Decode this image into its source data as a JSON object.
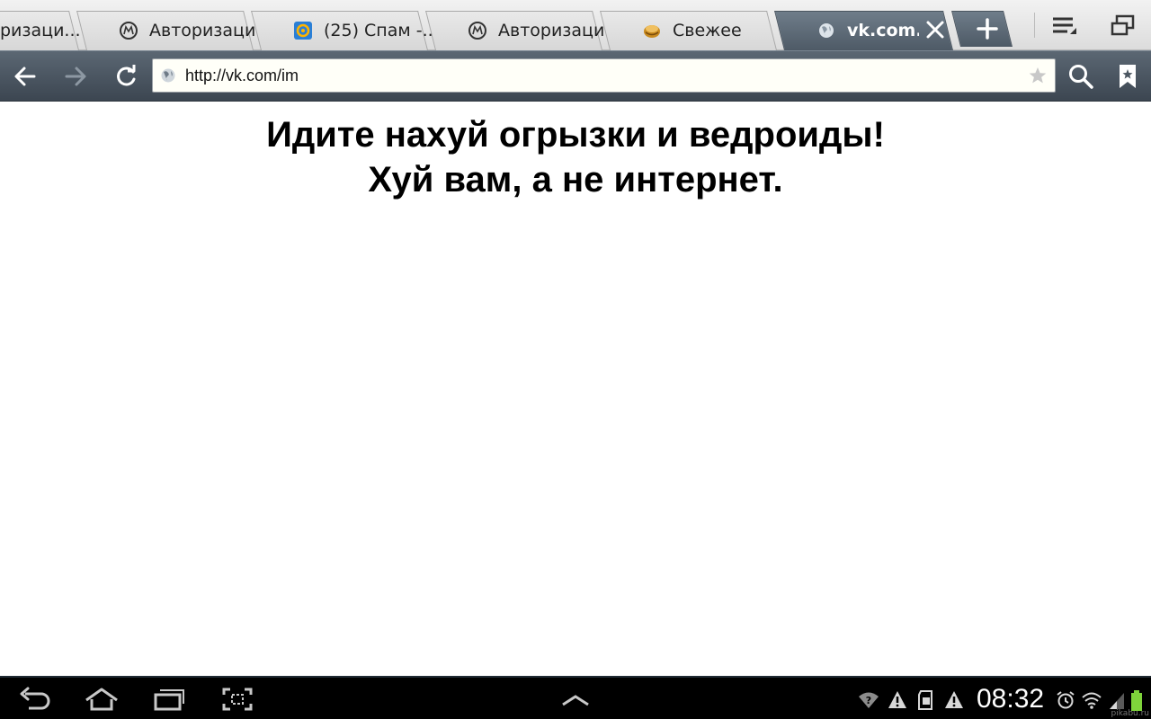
{
  "tabs": [
    {
      "label": "Авторизаци...",
      "partial_label": "ризаци...",
      "icon": "mailru-agent-icon"
    },
    {
      "label": "Авторизаци...",
      "icon": "mailru-agent-icon"
    },
    {
      "label": "(25) Спам -...",
      "icon": "mailru-mail-icon"
    },
    {
      "label": "Авторизаци...",
      "icon": "mailru-agent-icon"
    },
    {
      "label": "Свежее",
      "icon": "pikabu-icon"
    },
    {
      "label": "vk.com...",
      "icon": "globe-icon",
      "active": true
    }
  ],
  "address_bar": {
    "url": "http://vk.com/im"
  },
  "page": {
    "line1": "Идите нахуй огрызки и ведроиды!",
    "line2": "Хуй вам, а не интернет."
  },
  "status_bar": {
    "time": "08:32"
  },
  "watermark": "pikabu.ru",
  "colors": {
    "toolbar": "#4b5661",
    "active_tab": "#5c6874",
    "system_bar": "#000000",
    "battery": "#7fd43b"
  }
}
